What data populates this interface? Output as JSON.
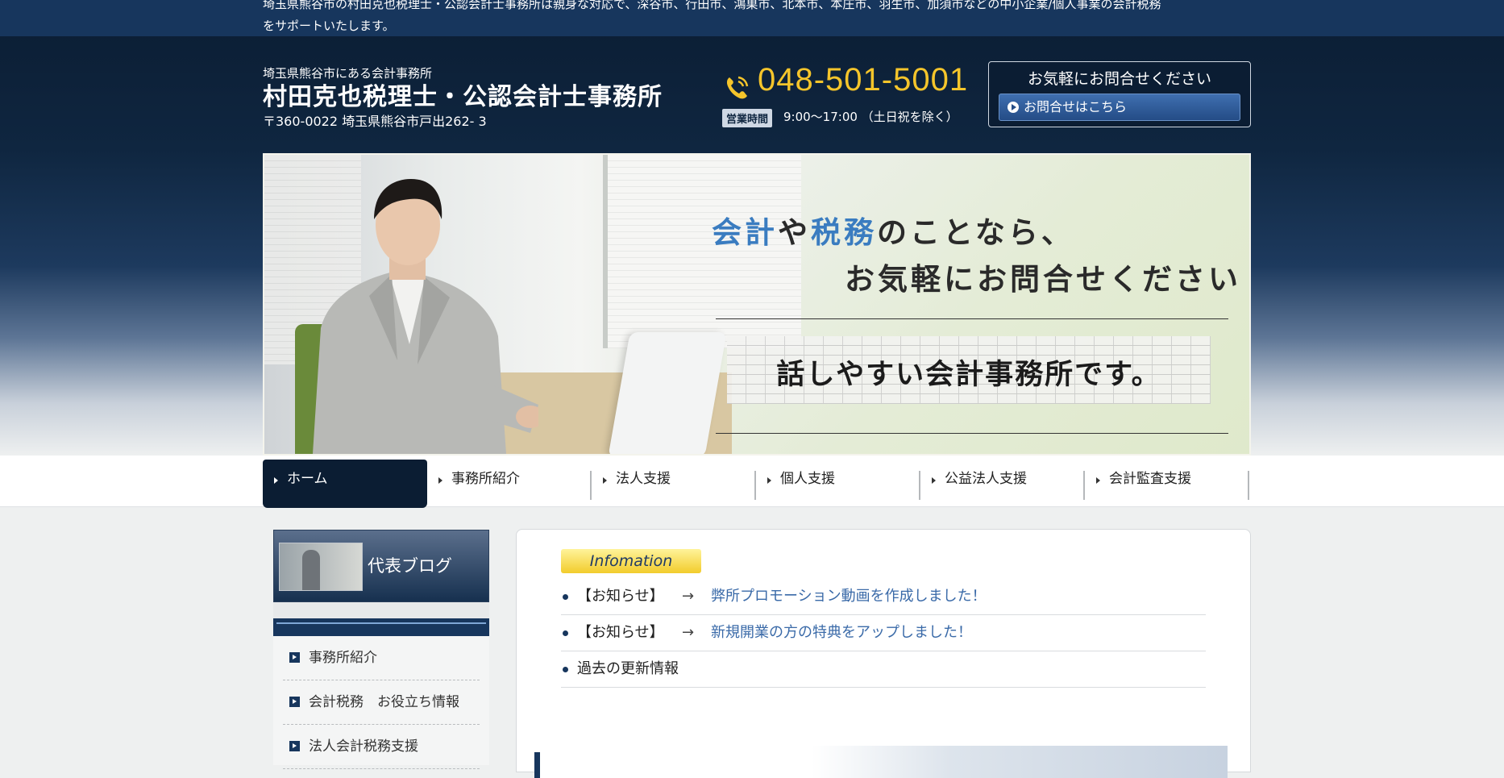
{
  "topbar": {
    "text_line1": "埼玉県熊谷市の村田克也税理士・公認会計士事務所は親身な対応で、深谷市、行田市、鴻巣市、北本市、本庄市、羽生市、加須市などの中小企業/個人事業の会計税務",
    "text_line2": "をサポートいたします。"
  },
  "header": {
    "subtitle": "埼玉県熊谷市にある会計事務所",
    "title": "村田克也税理士・公認会計士事務所",
    "address": "〒360-0022 埼玉県熊谷市戸出262- 3",
    "phone": "048-501-5001",
    "hours_label": "営業時間",
    "hours": "9:00～17:00 （土日祝を除く）",
    "contact_title": "お気軽にお問合せください",
    "contact_button": "お問合せはこちら"
  },
  "hero": {
    "line1_a": "会計",
    "line1_b": "や",
    "line1_c": "税務",
    "line1_d": "のことなら、",
    "line2": "お気軽にお問合せください",
    "tagline": "話しやすい会計事務所です。"
  },
  "nav": {
    "items": [
      {
        "label": "ホーム"
      },
      {
        "label": "事務所紹介"
      },
      {
        "label": "法人支援"
      },
      {
        "label": "個人支援"
      },
      {
        "label": "公益法人支援"
      },
      {
        "label": "会計監査支援"
      }
    ]
  },
  "sidebar": {
    "blog_title": "代表ブログ",
    "menu": [
      {
        "label": "事務所紹介"
      },
      {
        "label": "会計税務　お役立ち情報"
      },
      {
        "label": "法人会計税務支援"
      }
    ]
  },
  "main": {
    "info_badge": "Infomation",
    "news": [
      {
        "tag": "【お知らせ】",
        "arrow": "→",
        "text": "弊所プロモーション動画を作成しました！"
      },
      {
        "tag": "【お知らせ】",
        "arrow": "→",
        "text": "新規開業の方の特典をアップしました！"
      }
    ],
    "archive": "過去の更新情報"
  },
  "colors": {
    "navy": "#0b1d33",
    "topbar": "#17365d",
    "phone": "#f5c52b",
    "link": "#3a6aa8",
    "accent_blue": "#3a7cc0"
  }
}
